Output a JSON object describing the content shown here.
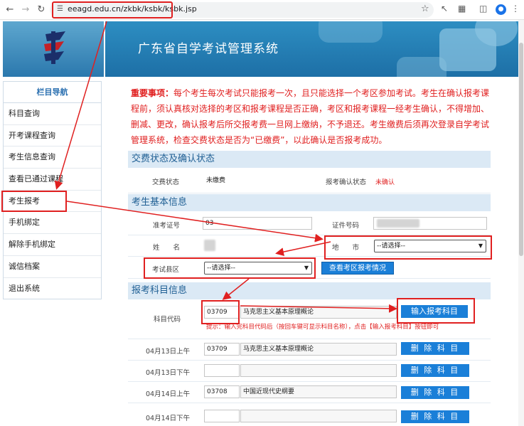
{
  "browser": {
    "url": "eeagd.edu.cn/zkbk/ksbk/ksbk.jsp",
    "avatar_letter": "",
    "accent": "#e02020"
  },
  "banner": {
    "title": "广东省自学考试管理系统"
  },
  "sidebar": {
    "title": "栏目导航",
    "items": [
      {
        "label": "科目查询"
      },
      {
        "label": "开考课程查询"
      },
      {
        "label": "考生信息查询"
      },
      {
        "label": "查看已通过课程"
      },
      {
        "label": "考生报考"
      },
      {
        "label": "手机绑定"
      },
      {
        "label": "解除手机绑定"
      },
      {
        "label": "诚信档案"
      },
      {
        "label": "退出系统"
      }
    ]
  },
  "notice": {
    "prefix": "重要事项：",
    "text": "每个考生每次考试只能报考一次，且只能选择一个考区参加考试。考生在确认报考课程前，须认真核对选择的考区和报考课程是否正确，考区和报考课程一经考生确认，不得增加、删减、更改，确认报考后所交报考费一旦网上缴纳，不予退还。考生缴费后须再次登录自学考试管理系统，检查交费状态是否为“已缴费”，以此确认是否报考成功。"
  },
  "payment": {
    "title": "交费状态及确认状态",
    "pay_label": "交费状态",
    "pay_value": "未缴费",
    "confirm_label": "报考确认状态",
    "confirm_value": "未确认"
  },
  "basic": {
    "title": "考生基本信息",
    "ticket_label": "准考证号",
    "ticket_value": "03",
    "id_label": "证件号码",
    "name_label": "姓　　名",
    "city_label": "地　　市",
    "city_select": "--请选择--",
    "district_label": "考试县区",
    "district_select": "--请选择--",
    "view_button": "查看考区报考情况"
  },
  "subjects": {
    "title": "报考科目信息",
    "code_label": "科目代码",
    "code_value": "03709",
    "name_value": "马克思主义基本原理概论",
    "enter_button": "输入报考科目",
    "hint": "提示：输入完科目代码后（按回车键可显示科目名称），点击【输入报考科目】按钮即可",
    "delete_label": "删 除 科 目",
    "rows": [
      {
        "slot": "04月13日上午",
        "code": "03709",
        "name": "马克思主义基本原理概论"
      },
      {
        "slot": "04月13日下午",
        "code": "",
        "name": ""
      },
      {
        "slot": "04月14日上午",
        "code": "03708",
        "name": "中国近现代史纲要"
      },
      {
        "slot": "04月14日下午",
        "code": "",
        "name": ""
      }
    ]
  }
}
